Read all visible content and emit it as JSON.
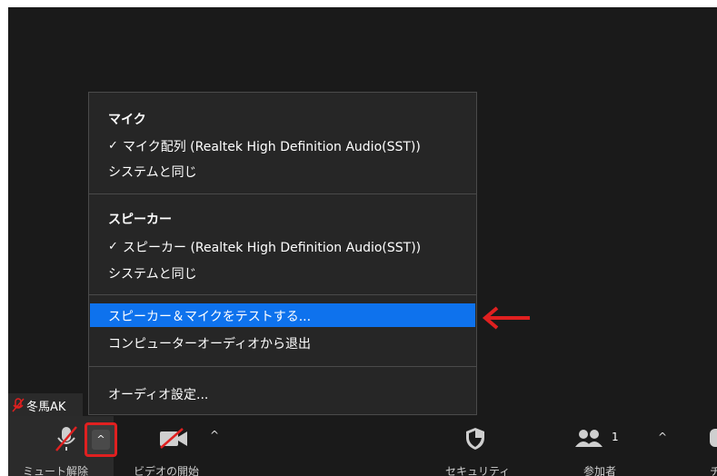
{
  "menu": {
    "mic_section_title": "マイク",
    "mic_items": [
      {
        "label": "マイク配列 (Realtek High Definition Audio(SST))",
        "checked": true
      },
      {
        "label": "システムと同じ",
        "checked": false
      }
    ],
    "speaker_section_title": "スピーカー",
    "speaker_items": [
      {
        "label": "スピーカー (Realtek High Definition Audio(SST))",
        "checked": true
      },
      {
        "label": "システムと同じ",
        "checked": false
      }
    ],
    "actions": [
      {
        "label": "スピーカー＆マイクをテストする...",
        "highlighted": true
      },
      {
        "label": "コンピューターオーディオから退出",
        "highlighted": false
      }
    ],
    "settings_label": "オーディオ設定...",
    "check_glyph": "✓"
  },
  "nametag": {
    "name": "冬馬AK"
  },
  "toolbar": {
    "unmute_label": "ミュート解除",
    "start_video_label": "ビデオの開始",
    "security_label": "セキュリティ",
    "participants_label": "参加者",
    "participants_count": "1",
    "chat_label_partial": "チ",
    "caret_glyph": "^"
  },
  "colors": {
    "accent_blue": "#0e72ed",
    "highlight_red": "#e02020",
    "muted_red": "#e02020"
  }
}
